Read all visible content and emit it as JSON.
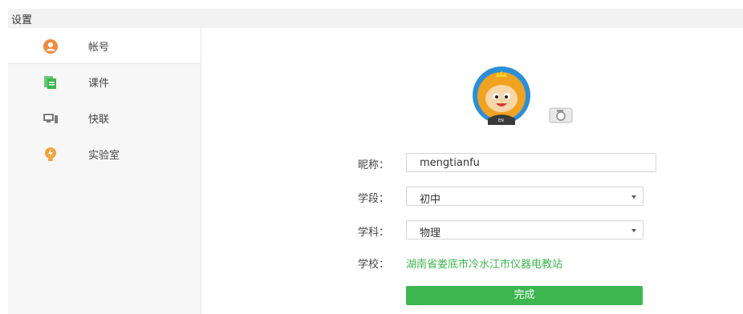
{
  "header": {
    "title": "设置"
  },
  "sidebar": {
    "items": [
      {
        "label": "帐号",
        "icon": "user-circle-icon",
        "active": true
      },
      {
        "label": "课件",
        "icon": "courseware-icon",
        "active": false
      },
      {
        "label": "快联",
        "icon": "monitor-link-icon",
        "active": false
      },
      {
        "label": "实验室",
        "icon": "lightbulb-icon",
        "active": false
      }
    ]
  },
  "profile": {
    "avatar_icon": "lion-avatar",
    "camera_icon": "camera-icon",
    "nickname": {
      "label": "昵称：",
      "value": "mengtianfu"
    },
    "stage": {
      "label": "学段：",
      "value": "初中"
    },
    "subject": {
      "label": "学科：",
      "value": "物理"
    },
    "school": {
      "label": "学校：",
      "value": "湖南省娄底市冷水江市仪器电教站"
    },
    "submit_label": "完成"
  },
  "colors": {
    "accent": "#3cb64e",
    "avatar_ring": "#2b8fd8",
    "user_icon": "#f08a3c",
    "courseware_icon": "#3cb64e",
    "monitor_icon": "#7a7a7a",
    "lab_icon": "#f0a23c"
  }
}
